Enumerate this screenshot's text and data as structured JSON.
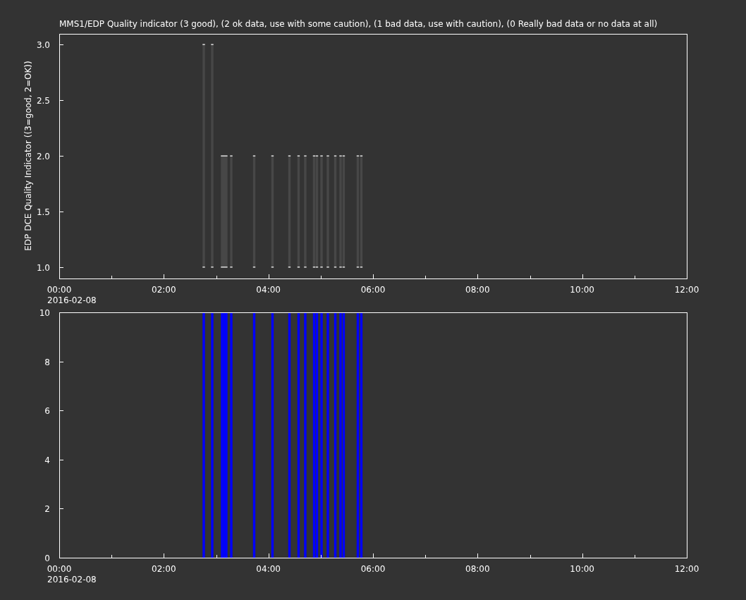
{
  "title": "MMS1/EDP  Quality indicator (3 good), (2 ok data, use with some caution), (1 bad data, use with caution), (0 Really bad data or no data at all)",
  "panels": [
    {
      "chart_data": {
        "type": "area",
        "ylabel": "EDP DCE Quality Indicator ((3=good, 2=OK))",
        "x": [
          2.764,
          2.926,
          3.114,
          3.155,
          3.195,
          3.29,
          3.728,
          4.078,
          4.402,
          4.577,
          4.705,
          4.874,
          4.928,
          5.016,
          5.137,
          5.279,
          5.38,
          5.44,
          5.71,
          5.777
        ],
        "series": [
          {
            "color": "#474747",
            "values": [
              3,
              3,
              2,
              2,
              2,
              2,
              2,
              2,
              2,
              2,
              2,
              2,
              2,
              2,
              2,
              2,
              2,
              2,
              2,
              2
            ]
          }
        ],
        "xlim": [
          0,
          12
        ],
        "ylim": [
          0.899,
          3.095
        ],
        "xticks": [
          {
            "value": 0,
            "label": "00:00"
          },
          {
            "value": 2,
            "label": "02:00"
          },
          {
            "value": 4,
            "label": "04:00"
          },
          {
            "value": 6,
            "label": "06:00"
          },
          {
            "value": 8,
            "label": "08:00"
          },
          {
            "value": 10,
            "label": "10:00"
          },
          {
            "value": 12,
            "label": "12:00"
          }
        ],
        "yticks": [
          {
            "value": 1,
            "label": "1.0"
          },
          {
            "value": 1.5,
            "label": "1.5"
          },
          {
            "value": 2,
            "label": "2.0"
          },
          {
            "value": 2.5,
            "label": "2.5"
          },
          {
            "value": 3,
            "label": "3.0"
          }
        ]
      },
      "date_label": "2016-02-08"
    },
    {
      "chart_data": {
        "type": "bar",
        "x": [
          2.764,
          2.926,
          3.114,
          3.155,
          3.195,
          3.29,
          3.728,
          4.078,
          4.402,
          4.577,
          4.705,
          4.874,
          4.928,
          5.016,
          5.137,
          5.279,
          5.38,
          5.44,
          5.71,
          5.777
        ],
        "series": [
          {
            "color": "#0000ff",
            "values": [
              10,
              10,
              10,
              10,
              10,
              10,
              10,
              10,
              10,
              10,
              10,
              10,
              10,
              10,
              10,
              10,
              10,
              10,
              10,
              10
            ]
          }
        ],
        "xlim": [
          0,
          12
        ],
        "ylim": [
          0,
          10
        ],
        "xticks": [
          {
            "value": 0,
            "label": "00:00"
          },
          {
            "value": 2,
            "label": "02:00"
          },
          {
            "value": 4,
            "label": "04:00"
          },
          {
            "value": 6,
            "label": "06:00"
          },
          {
            "value": 8,
            "label": "08:00"
          },
          {
            "value": 10,
            "label": "10:00"
          },
          {
            "value": 12,
            "label": "12:00"
          }
        ],
        "yticks": [
          {
            "value": 0,
            "label": "0"
          },
          {
            "value": 2,
            "label": "2"
          },
          {
            "value": 4,
            "label": "4"
          },
          {
            "value": 6,
            "label": "6"
          },
          {
            "value": 8,
            "label": "8"
          },
          {
            "value": 10,
            "label": "10"
          }
        ]
      },
      "date_label": "2016-02-08"
    }
  ]
}
